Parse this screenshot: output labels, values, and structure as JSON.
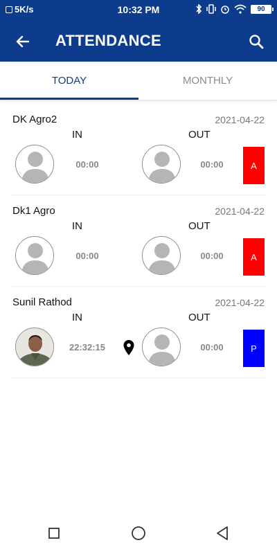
{
  "status_bar": {
    "speed": "5K/s",
    "time": "10:32 PM",
    "battery": "90"
  },
  "header": {
    "title": "ATTENDANCE"
  },
  "tabs": [
    {
      "label": "TODAY",
      "active": true
    },
    {
      "label": "MONTHLY",
      "active": false
    }
  ],
  "labels": {
    "in": "IN",
    "out": "OUT"
  },
  "records": [
    {
      "name": "DK Agro2",
      "date": "2021-04-22",
      "in_time": "00:00",
      "out_time": "00:00",
      "status": "A",
      "status_color": "#ff0000",
      "in_photo": false,
      "has_location": false
    },
    {
      "name": "Dk1 Agro",
      "date": "2021-04-22",
      "in_time": "00:00",
      "out_time": "00:00",
      "status": "A",
      "status_color": "#ff0000",
      "in_photo": false,
      "has_location": false
    },
    {
      "name": "Sunil Rathod",
      "date": "2021-04-22",
      "in_time": "22:32:15",
      "out_time": "00:00",
      "status": "P",
      "status_color": "#0000ff",
      "in_photo": true,
      "has_location": true
    }
  ],
  "colors": {
    "primary": "#0d3c8c",
    "absent": "#ff0000",
    "present": "#0000ff"
  }
}
